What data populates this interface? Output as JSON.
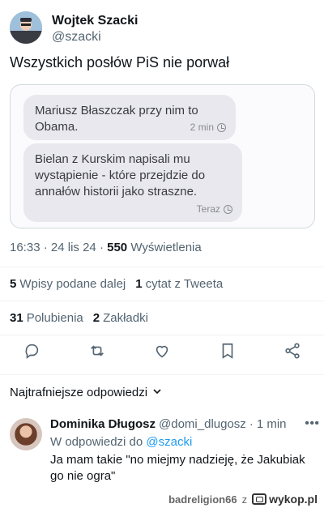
{
  "tweet": {
    "display_name": "Wojtek Szacki",
    "handle": "@szacki",
    "text": "Wszystkich posłów PiS nie porwał",
    "media": {
      "bubbles": [
        {
          "text": "Mariusz Błaszczak przy nim to Obama.",
          "time": "2 min"
        },
        {
          "text": "Bielan z Kurskim napisali mu wystąpienie - które przejdzie do annałów historii jako straszne.",
          "time": "Teraz"
        }
      ]
    },
    "time": "16:33",
    "date": "24 lis 24",
    "views_count": "550",
    "views_label": "Wyświetlenia",
    "retweets_count": "5",
    "retweets_label": "Wpisy podane dalej",
    "quotes_count": "1",
    "quotes_label": "cytat z Tweeta",
    "likes_count": "31",
    "likes_label": "Polubienia",
    "bookmarks_count": "2",
    "bookmarks_label": "Zakładki"
  },
  "replies_section": {
    "sort_label": "Najtrafniejsze odpowiedzi"
  },
  "reply": {
    "display_name": "Dominika Długosz",
    "handle": "@domi_dlugosz",
    "age": "1 min",
    "reply_to_prefix": "W odpowiedzi do",
    "reply_to_handle": "@szacki",
    "text": "Ja mam takie \"no miejmy nadzieję, że Jakubiak go nie ogra\""
  },
  "footer": {
    "username": "badreligion66",
    "separator": "z",
    "site": "wykop.pl"
  },
  "icons": {
    "actions": [
      "reply-icon",
      "retweet-icon",
      "like-icon",
      "bookmark-icon",
      "share-icon"
    ]
  },
  "colors": {
    "link": "#1d9bf0",
    "secondary_text": "#536471"
  }
}
